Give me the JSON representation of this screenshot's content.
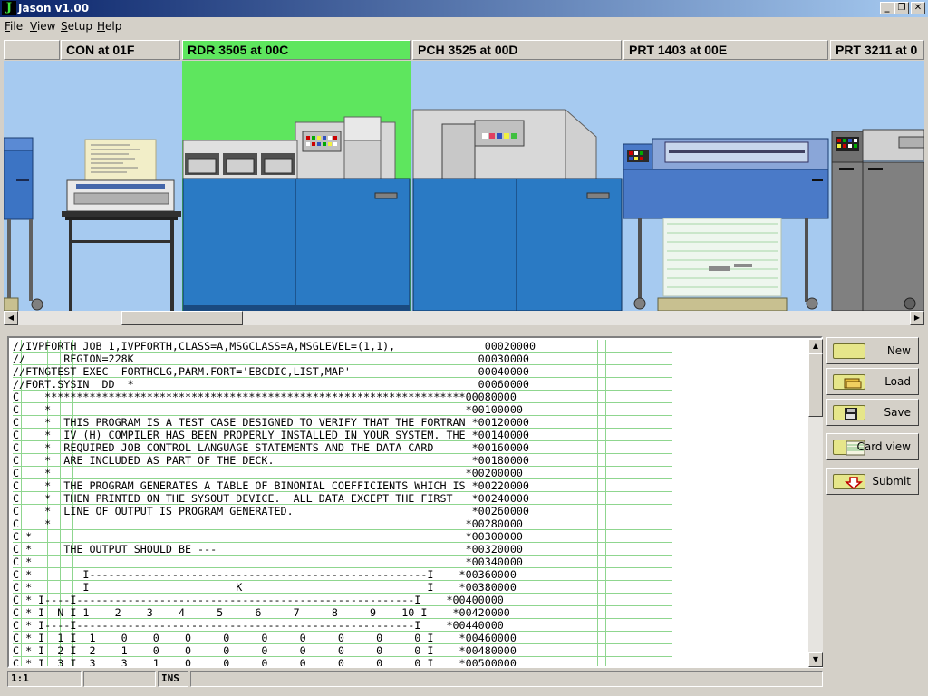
{
  "window": {
    "title": "Jason v1.00",
    "icon_letter": "J"
  },
  "menu": [
    {
      "label": "File",
      "u": "F",
      "rest": "ile"
    },
    {
      "label": "View",
      "u": "V",
      "rest": "iew"
    },
    {
      "label": "Setup",
      "u": "S",
      "rest": "etup"
    },
    {
      "label": "Help",
      "u": "H",
      "rest": "elp"
    }
  ],
  "devices": {
    "tabs": [
      {
        "label": "",
        "active": false
      },
      {
        "label": "CON at 01F",
        "active": false
      },
      {
        "label": "RDR 3505 at 00C",
        "active": true
      },
      {
        "label": "PCH 3525 at 00D",
        "active": false
      },
      {
        "label": "PRT 1403 at 00E",
        "active": false
      },
      {
        "label": "PRT 3211 at 0",
        "active": false
      }
    ],
    "active_color": "#5ee65e",
    "background_color": "#a6caf0"
  },
  "editor": {
    "lines": [
      "//IVPFORTH JOB 1,IVPFORTH,CLASS=A,MSGCLASS=A,MSGLEVEL=(1,1),              00020000",
      "//      REGION=228K                                                      00030000",
      "//FTNGTEST EXEC  FORTHCLG,PARM.FORT='EBCDIC,LIST,MAP'                    00040000",
      "//FORT.SYSIN  DD  *                                                      00060000",
      "C    ******************************************************************00080000",
      "C    *                                                                 *00100000",
      "C    *  THIS PROGRAM IS A TEST CASE DESIGNED TO VERIFY THAT THE FORTRAN *00120000",
      "C    *  IV (H) COMPILER HAS BEEN PROPERLY INSTALLED IN YOUR SYSTEM. THE *00140000",
      "C    *  REQUIRED JOB CONTROL LANGUAGE STATEMENTS AND THE DATA CARD      *00160000",
      "C    *  ARE INCLUDED AS PART OF THE DECK.                               *00180000",
      "C    *                                                                 *00200000",
      "C    *  THE PROGRAM GENERATES A TABLE OF BINOMIAL COEFFICIENTS WHICH IS *00220000",
      "C    *  THEN PRINTED ON THE SYSOUT DEVICE.  ALL DATA EXCEPT THE FIRST   *00240000",
      "C    *  LINE OF OUTPUT IS PROGRAM GENERATED.                            *00260000",
      "C    *                                                                 *00280000",
      "C *                                                                    *00300000",
      "C *     THE OUTPUT SHOULD BE ---                                       *00320000",
      "C *                                                                    *00340000",
      "C *        I-----------------------------------------------------I    *00360000",
      "C *        I                       K                             I    *00380000",
      "C * I----I-----------------------------------------------------I    *00400000",
      "C * I  N I 1    2    3    4     5     6     7     8     9    10 I    *00420000",
      "C * I----I-----------------------------------------------------I    *00440000",
      "C * I  1 I  1    0    0    0     0     0     0     0     0     0 I    *00460000",
      "C * I  2 I  2    1    0    0     0     0     0     0     0     0 I    *00480000",
      "C * I  3 I  3    3    1    0     0     0     0     0     0     0 I    *00500000"
    ]
  },
  "status": {
    "position": "1:1",
    "blank": "",
    "mode": "INS"
  },
  "side_buttons": [
    {
      "label": "New",
      "icon": "blank-card-icon"
    },
    {
      "label": "Load",
      "icon": "folder-open-icon"
    },
    {
      "label": "Save",
      "icon": "floppy-disk-icon"
    },
    {
      "label": "Card view",
      "icon": "punch-card-icon"
    },
    {
      "label": "Submit",
      "icon": "submit-arrow-icon"
    }
  ]
}
